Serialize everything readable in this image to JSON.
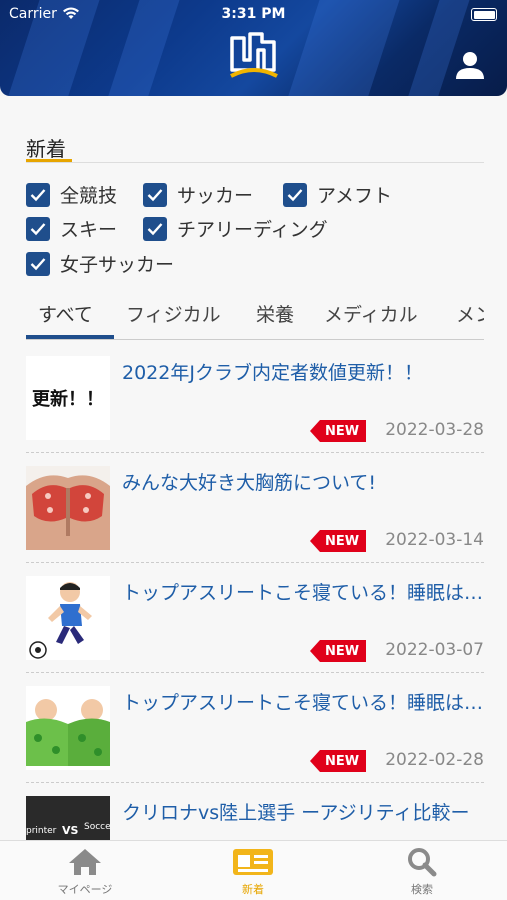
{
  "status_bar": {
    "carrier": "Carrier",
    "time": "3:31 PM"
  },
  "header": {
    "logo_icon": "logo-mark-icon",
    "user_icon": "user-icon"
  },
  "section": {
    "title": "新着"
  },
  "filters": [
    {
      "label": "全競技",
      "checked": true
    },
    {
      "label": "サッカー",
      "checked": true
    },
    {
      "label": "アメフト",
      "checked": true
    },
    {
      "label": "スキー",
      "checked": true
    },
    {
      "label": "チアリーディング",
      "checked": true
    },
    {
      "label": "女子サッカー",
      "checked": true
    }
  ],
  "tabs": [
    {
      "label": "すべて",
      "active": true
    },
    {
      "label": "フィジカル",
      "active": false
    },
    {
      "label": "栄養",
      "active": false
    },
    {
      "label": "メディカル",
      "active": false
    },
    {
      "label": "メンタル",
      "active": false
    }
  ],
  "articles": [
    {
      "title": "2022年Jクラブ内定者数値更新！！",
      "thumb_text": "更新！！",
      "badge": "NEW",
      "date": "2022-03-28"
    },
    {
      "title": "みんな大好き大胸筋について!",
      "badge": "NEW",
      "date": "2022-03-14"
    },
    {
      "title": "トップアスリートこそ寝ている！睡眠は最高のトレーニング",
      "badge": "NEW",
      "date": "2022-03-07"
    },
    {
      "title": "トップアスリートこそ寝ている！睡眠は最高のトレーニング",
      "badge": "NEW",
      "date": "2022-02-28"
    },
    {
      "title": "クリロナvs陸上選手 ーアジリティ比較ー",
      "thumb_text_left": "printer",
      "thumb_text_mid": "VS",
      "thumb_text_right": "Socce"
    }
  ],
  "tabbar": [
    {
      "label": "マイページ",
      "icon": "home-icon",
      "active": false
    },
    {
      "label": "新着",
      "icon": "news-icon",
      "active": true
    },
    {
      "label": "検索",
      "icon": "search-icon",
      "active": false
    }
  ],
  "colors": {
    "accent": "#1f4e8c",
    "active_tab": "#e7a500",
    "badge": "#e0001a",
    "link": "#1f5ea8"
  }
}
